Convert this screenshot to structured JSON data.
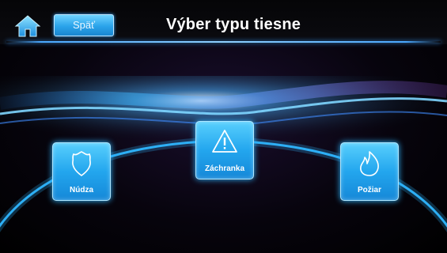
{
  "header": {
    "home_icon": "home-icon",
    "back_label": "Späť",
    "title": "Výber typu tiesne"
  },
  "tiles": [
    {
      "label": "Núdza",
      "icon": "police-badge-icon"
    },
    {
      "label": "Záchranka",
      "icon": "warning-triangle-icon"
    },
    {
      "label": "Požiar",
      "icon": "fire-icon"
    }
  ],
  "colors": {
    "accent": "#2aa3ea",
    "glow": "#4aa8ff",
    "background": "#000000",
    "text": "#ffffff"
  }
}
